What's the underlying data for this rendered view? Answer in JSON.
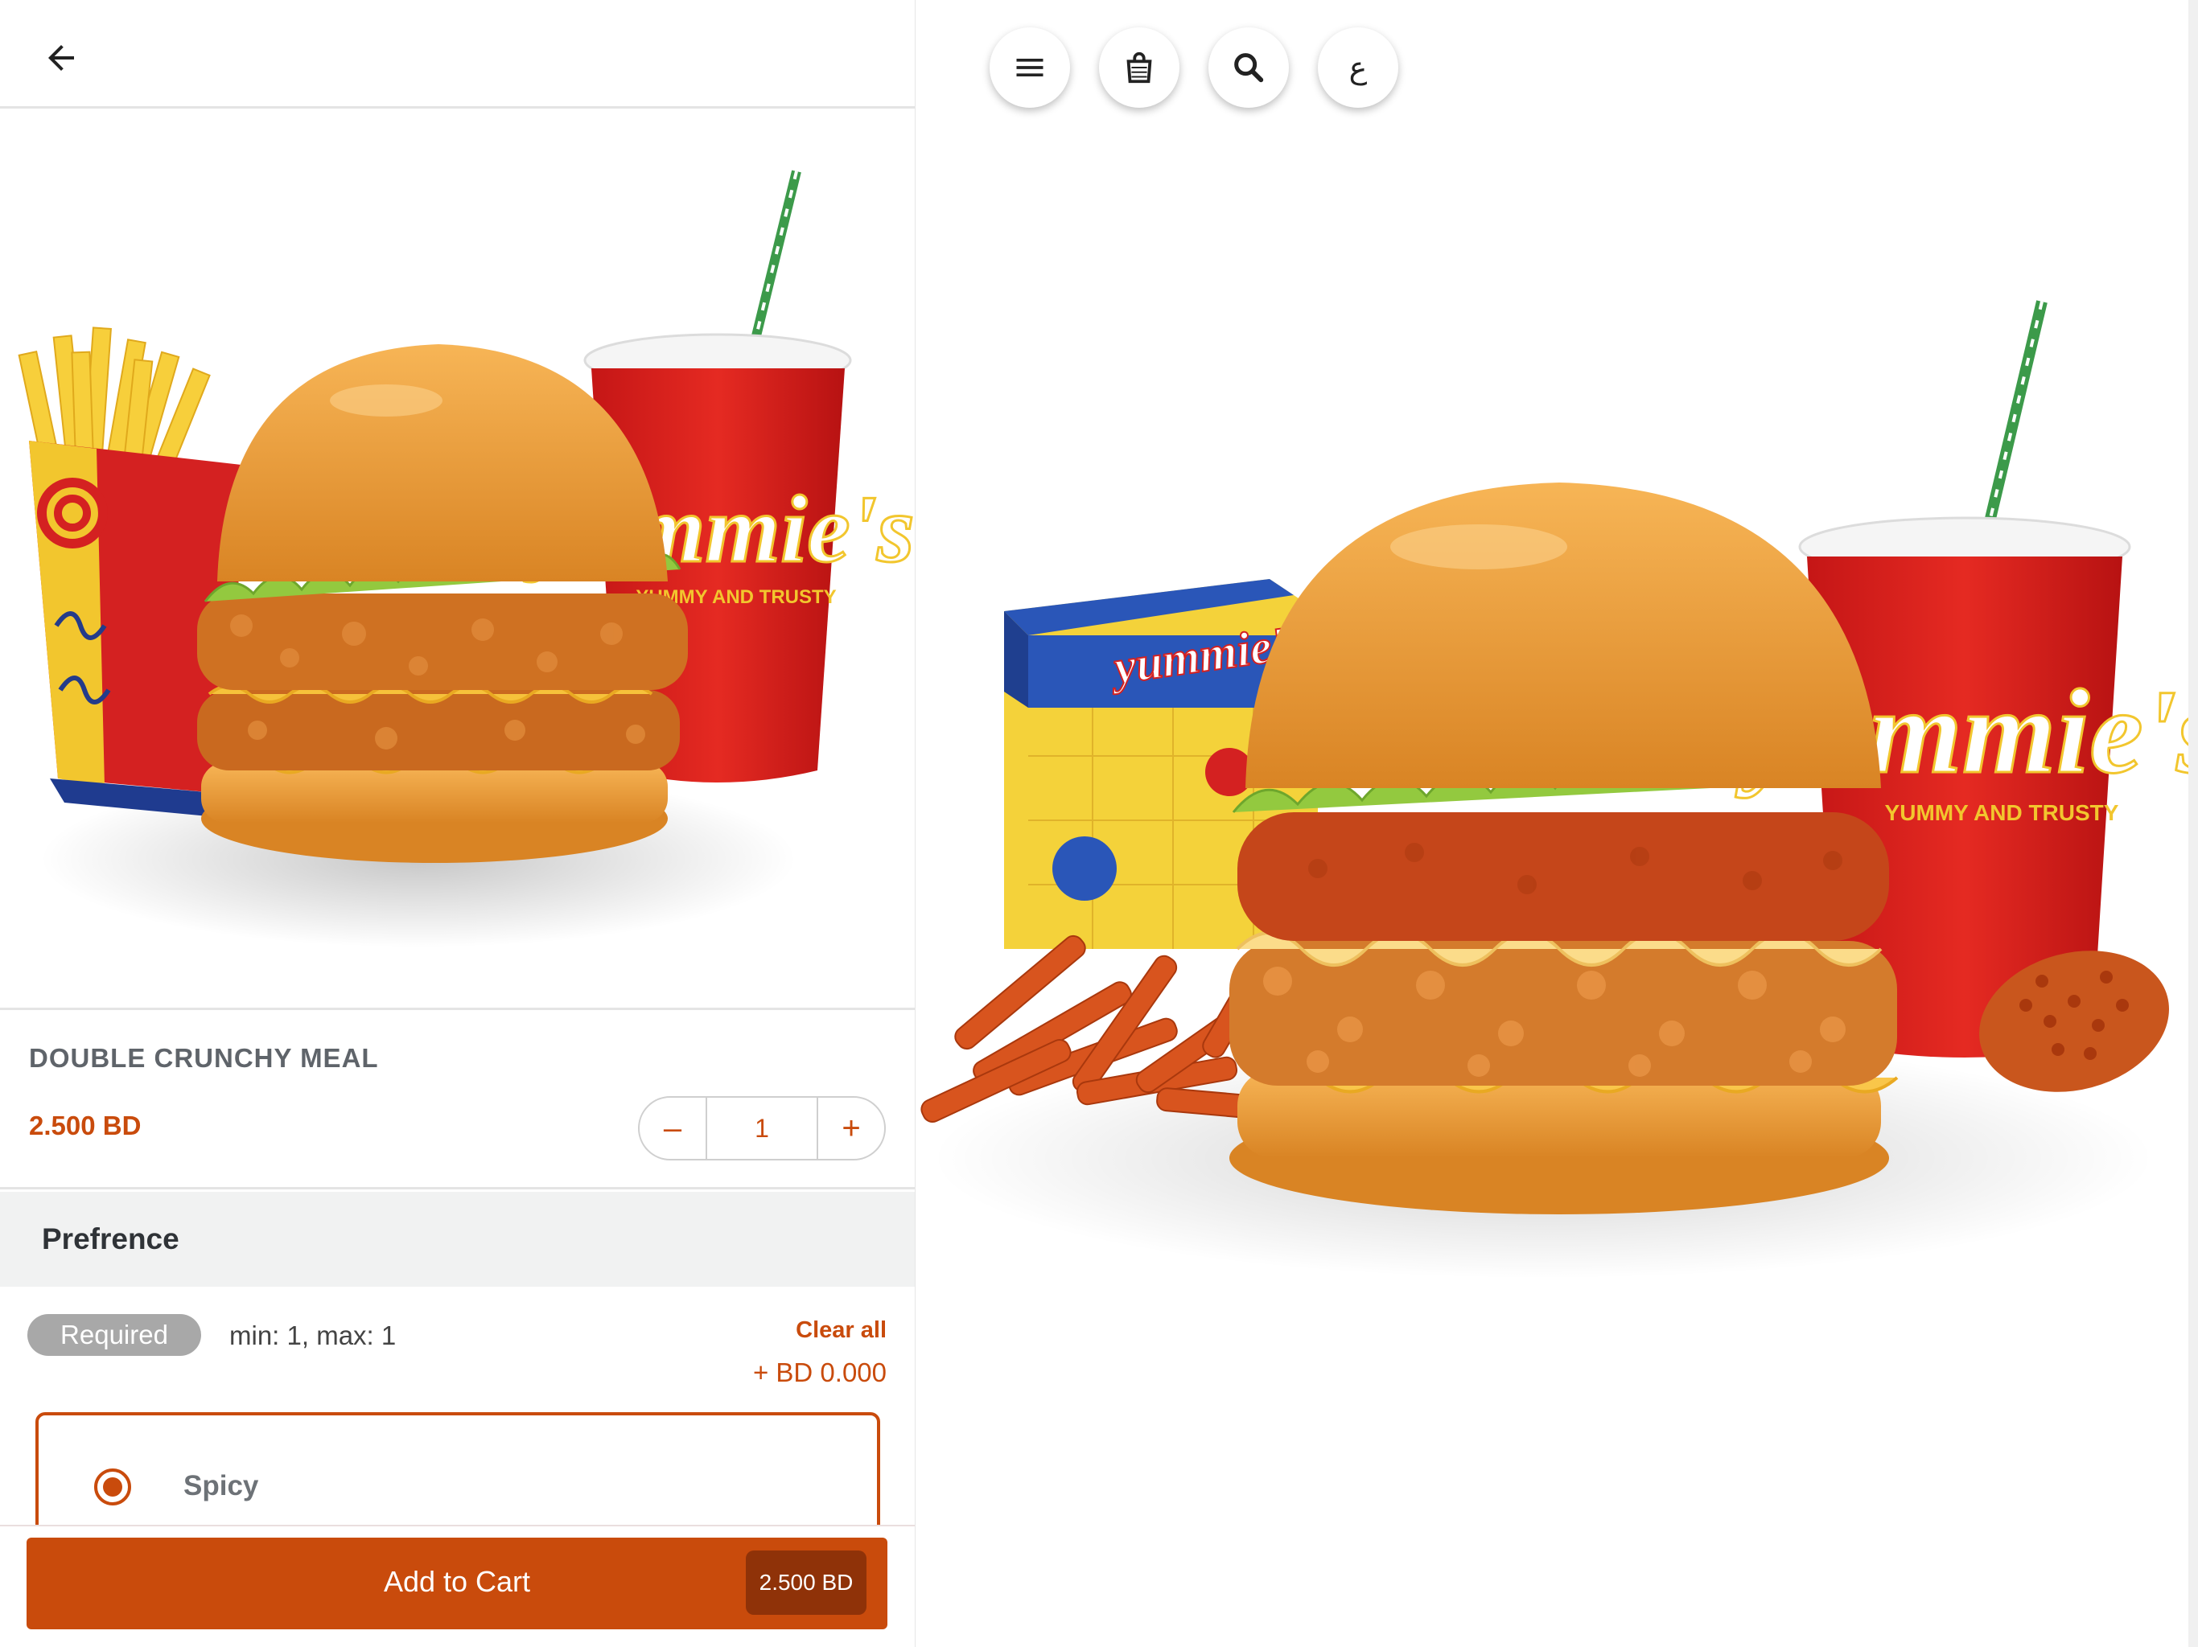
{
  "product": {
    "name": "DOUBLE CRUNCHY MEAL",
    "price": "2.500 BD",
    "quantity": "1"
  },
  "stepper": {
    "minus": "–",
    "plus": "+"
  },
  "preference": {
    "title": "Prefrence",
    "required_label": "Required",
    "minmax": "min: 1, max: 1",
    "clear_all": "Clear all",
    "extra_price": "+ BD 0.000",
    "options": [
      {
        "label": "Spicy",
        "selected": true
      }
    ]
  },
  "cart": {
    "button_label": "Add to Cart",
    "total": "2.500 BD"
  },
  "branding": {
    "cup_text": "yummie's",
    "tagline": "YUMMY AND TRUSTY"
  },
  "toolbar": {
    "language_label": "ع"
  },
  "colors": {
    "accent": "#c94b0c",
    "accent_dark": "#8f3208",
    "badge_gray": "#a8a8a8",
    "cup_red": "#d91e1e"
  }
}
